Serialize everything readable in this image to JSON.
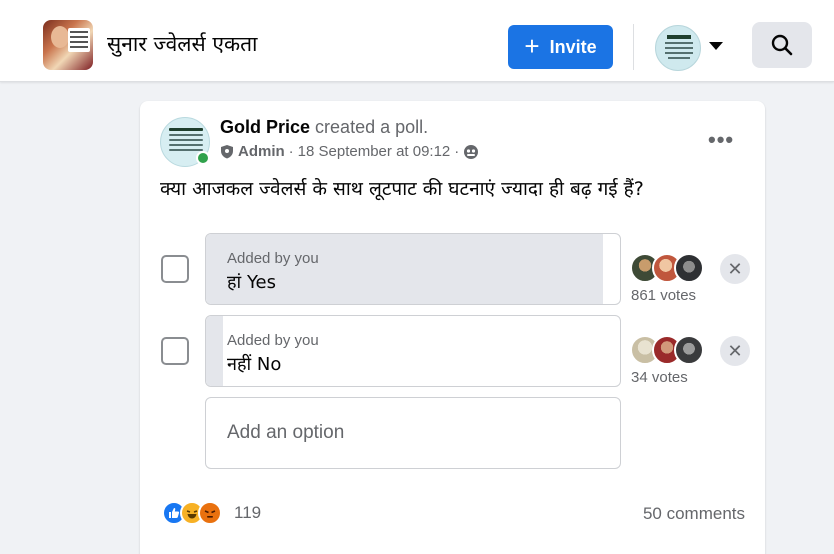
{
  "header": {
    "group_name": "सुनार ज्वेलर्स एकता",
    "invite_label": "Invite",
    "invite_icon": "plus-icon",
    "search_icon": "search-icon",
    "profile_menu_icon": "caret-down-icon"
  },
  "post": {
    "author": "Gold Price",
    "action": "created a poll.",
    "role": "Admin",
    "timestamp": "18 September at 09:12",
    "audience_icon": "group-audience-icon",
    "question": "क्या आजकल ज्वेलर्स के साथ लूटपाट की घटनाएं ज्यादा ही बढ़ गई हैं?",
    "options": [
      {
        "added_by": "Added by you",
        "text": "हां Yes",
        "votes": "861 votes",
        "share": 0.96
      },
      {
        "added_by": "Added by you",
        "text": "नहीं No",
        "votes": "34 votes",
        "share": 0.04
      }
    ],
    "add_option_placeholder": "Add an option",
    "reactions": [
      "like",
      "haha",
      "angry"
    ],
    "reaction_count": "119",
    "comments": "50 comments"
  },
  "colors": {
    "primary": "#1b74e4",
    "online": "#31a24c",
    "bar_fill": "#e4e6eb"
  }
}
